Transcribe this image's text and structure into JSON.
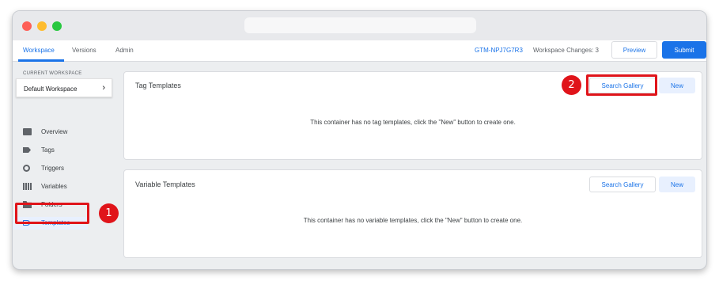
{
  "colors": {
    "accent": "#1a73e8",
    "annotation_red": "#e0141a"
  },
  "nav": {
    "tabs": [
      {
        "label": "Workspace"
      },
      {
        "label": "Versions"
      },
      {
        "label": "Admin"
      }
    ],
    "container_id": "GTM-NPJ7G7R3",
    "workspace_changes": "Workspace Changes: 3",
    "preview_label": "Preview",
    "submit_label": "Submit"
  },
  "sidebar": {
    "current_workspace_label": "CURRENT WORKSPACE",
    "workspace_name": "Default Workspace",
    "items": [
      {
        "label": "Overview",
        "icon": "overview-icon"
      },
      {
        "label": "Tags",
        "icon": "tag-icon"
      },
      {
        "label": "Triggers",
        "icon": "trigger-icon"
      },
      {
        "label": "Variables",
        "icon": "variables-icon"
      },
      {
        "label": "Folders",
        "icon": "folder-icon"
      },
      {
        "label": "Templates",
        "icon": "template-icon"
      }
    ]
  },
  "annotations": {
    "step1": "1",
    "step2": "2"
  },
  "tag_templates": {
    "title": "Tag Templates",
    "search_label": "Search Gallery",
    "new_label": "New",
    "empty_message": "This container has no tag templates, click the \"New\" button to create one."
  },
  "variable_templates": {
    "title": "Variable Templates",
    "search_label": "Search Gallery",
    "new_label": "New",
    "empty_message": "This container has no variable templates, click the \"New\" button to create one."
  }
}
